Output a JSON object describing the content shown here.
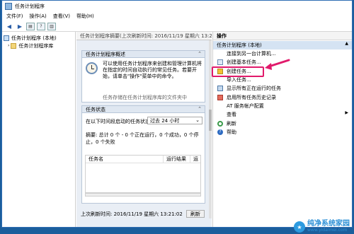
{
  "window": {
    "title": "任务计划程序"
  },
  "menu": [
    "文件(F)",
    "操作(A)",
    "查看(V)",
    "帮助(H)"
  ],
  "tree": {
    "root": "任务计划程序 (本地)",
    "child": "任务计划程序库"
  },
  "mid": {
    "header": "任务计划程序摘要(上次刷新时间: 2016/11/19 星期六 13:21:02)",
    "overview": {
      "title": "任务计划程序概述",
      "text": "可以使用任务计划程序来创建和管理计算机将在指定的时间自动执行的常见任务。若要开始，请单击\"操作\"菜单中的命令。",
      "text_cut": "任务存储在任务计划程序库的文件夹中"
    },
    "status": {
      "title": "任务状态",
      "filter_label": "在以下时间段启动的任务状态",
      "filter_value": "过去 24 小时",
      "summary": "摘要: 总计 0 个 - 0 个正在运行，0 个成功，0 个停止，0 个失败",
      "col_name": "任务名",
      "col_result": "运行结果",
      "col_extra": "运"
    },
    "footer": {
      "refreshed": "上次刷新时间: 2016/11/19 星期六 13:21:02",
      "refresh_btn": "刷新"
    }
  },
  "actions": {
    "header": "操作",
    "section": "任务计划程序 (本地)",
    "items": [
      "连接到另一台计算机...",
      "创建基本任务...",
      "创建任务...",
      "导入任务...",
      "显示所有正在运行的任务",
      "启用所有任务历史记录",
      "AT 服务帐户配置",
      "查看",
      "刷新",
      "帮助"
    ]
  },
  "watermark": {
    "brand": "纯净系统家园",
    "url": "www.yidaimei.com"
  },
  "colors": {
    "highlight": "#e11a6b",
    "selection": "#d5e3f3",
    "frame": "#1b5e9c"
  }
}
